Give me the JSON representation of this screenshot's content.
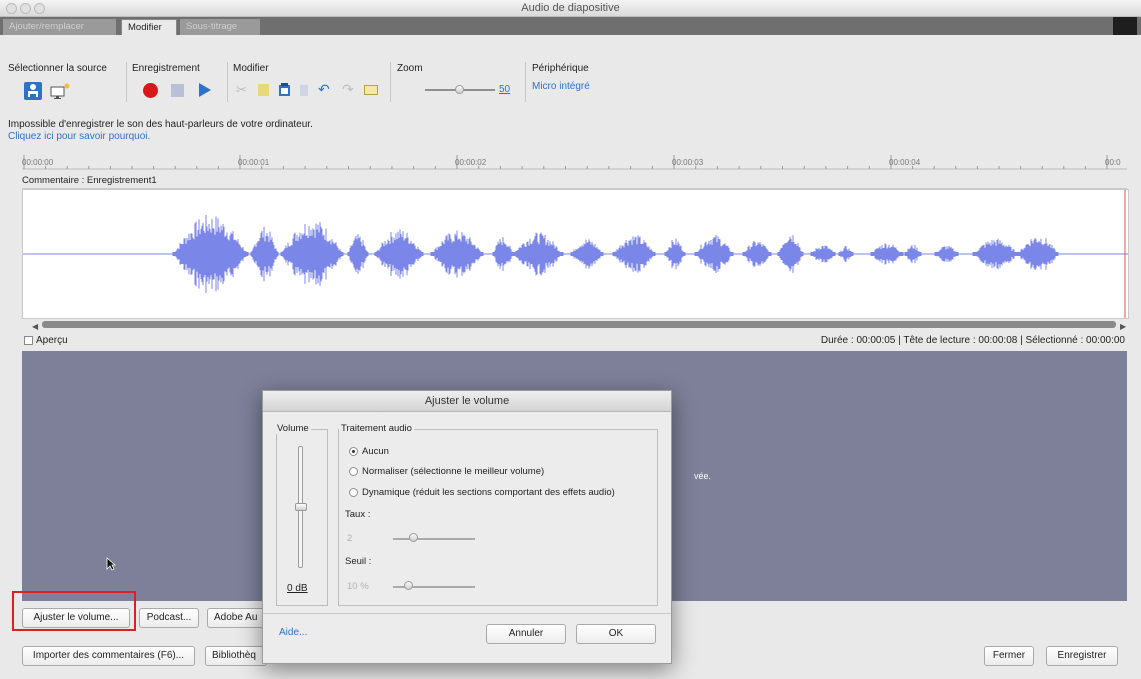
{
  "window": {
    "title": "Audio de diapositive"
  },
  "tabs": [
    {
      "label": "Ajouter/remplacer"
    },
    {
      "label": "Modifier"
    },
    {
      "label": "Sous-titrage"
    }
  ],
  "toolbar": {
    "source_label": "Sélectionner la source",
    "recording_label": "Enregistrement",
    "edit_label": "Modifier",
    "zoom_label": "Zoom",
    "zoom_value": "50",
    "device_label": "Périphérique",
    "device_value": "Micro intégré"
  },
  "notice": {
    "message": "Impossible d'enregistrer le son des haut-parleurs de votre ordinateur.",
    "link": "Cliquez ici pour savoir pourquoi."
  },
  "timeline": {
    "ticks": [
      "00:00:00",
      "00:00:01",
      "00:00:02",
      "00:00:03",
      "00:00:04",
      "00:0"
    ]
  },
  "track": {
    "label": "Commentaire : Enregistrement1"
  },
  "status": {
    "preview_label": "Aperçu",
    "info": "Durée : 00:00:05 | Tête de lecture : 00:00:08 | Sélectionné : 00:00:00"
  },
  "panel": {
    "partial_text": "vée."
  },
  "buttons": {
    "adjust_volume": "Ajuster le volume...",
    "podcast": "Podcast...",
    "adobe": "Adobe Au",
    "import_comments": "Importer des commentaires (F6)...",
    "library": "Bibliothèq",
    "close": "Fermer",
    "save": "Enregistrer"
  },
  "dialog": {
    "title": "Ajuster le volume",
    "volume_group": "Volume",
    "volume_value": "0 dB",
    "volume_level": 0.5,
    "processing_group": "Traitement audio",
    "options": [
      {
        "label": "Aucun",
        "selected": true
      },
      {
        "label": "Normaliser (sélectionne le meilleur volume)",
        "selected": false
      },
      {
        "label": "Dynamique (réduit les sections comportant des effets audio)",
        "selected": false
      }
    ],
    "rate_label": "Taux :",
    "rate_value": "2",
    "threshold_label": "Seuil :",
    "threshold_value": "10 %",
    "help_link": "Aide...",
    "cancel": "Annuler",
    "ok": "OK"
  },
  "colors": {
    "accent_blue": "#2d72c9",
    "waveform": "#7a86e8",
    "record_red": "#d7191c",
    "panel_bg": "#7e809a",
    "highlight_border": "#e02020"
  }
}
